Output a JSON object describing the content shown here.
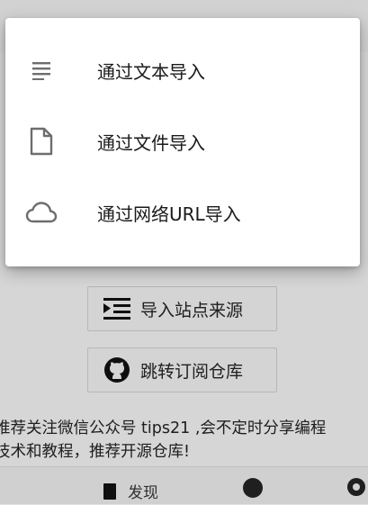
{
  "menu": {
    "items": [
      {
        "label": "通过文本导入",
        "icon": "text-lines-icon"
      },
      {
        "label": "通过文件导入",
        "icon": "file-icon"
      },
      {
        "label": "通过网络URL导入",
        "icon": "cloud-icon"
      }
    ]
  },
  "background": {
    "buttons": [
      {
        "label": "导入站点来源",
        "icon": "import-list-icon"
      },
      {
        "label": "跳转订阅仓库",
        "icon": "github-icon"
      }
    ],
    "note_line1": "推荐关注微信公众号 tips21 ,会不定时分享编程",
    "note_line2": "技术和教程，推荐开源仓库!",
    "bottom_tab_label": "发现"
  },
  "colors": {
    "menu_bg": "#ffffff",
    "icon_gray": "#6d6d6d",
    "scrim": "#e6e6e6"
  }
}
